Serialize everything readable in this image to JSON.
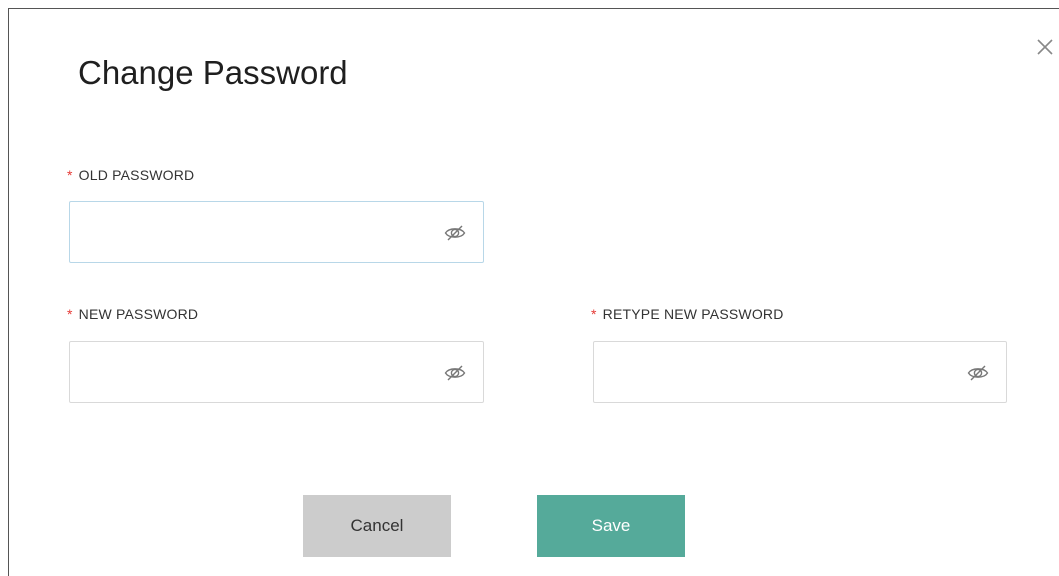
{
  "dialog": {
    "title": "Change Password",
    "close_icon": "close-icon"
  },
  "fields": {
    "required_marker": "*",
    "old_password": {
      "label": "OLD PASSWORD",
      "value": "",
      "placeholder": "",
      "icon": "eye-off-icon"
    },
    "new_password": {
      "label": "NEW PASSWORD",
      "value": "",
      "placeholder": "",
      "icon": "eye-off-icon"
    },
    "retype_password": {
      "label": "RETYPE NEW PASSWORD",
      "value": "",
      "placeholder": "",
      "icon": "eye-off-icon"
    }
  },
  "buttons": {
    "cancel_label": "Cancel",
    "save_label": "Save"
  },
  "colors": {
    "required": "#e53935",
    "save_bg": "#55aa9a",
    "cancel_bg": "#cccccc",
    "focus_border": "#b8d7e8"
  }
}
